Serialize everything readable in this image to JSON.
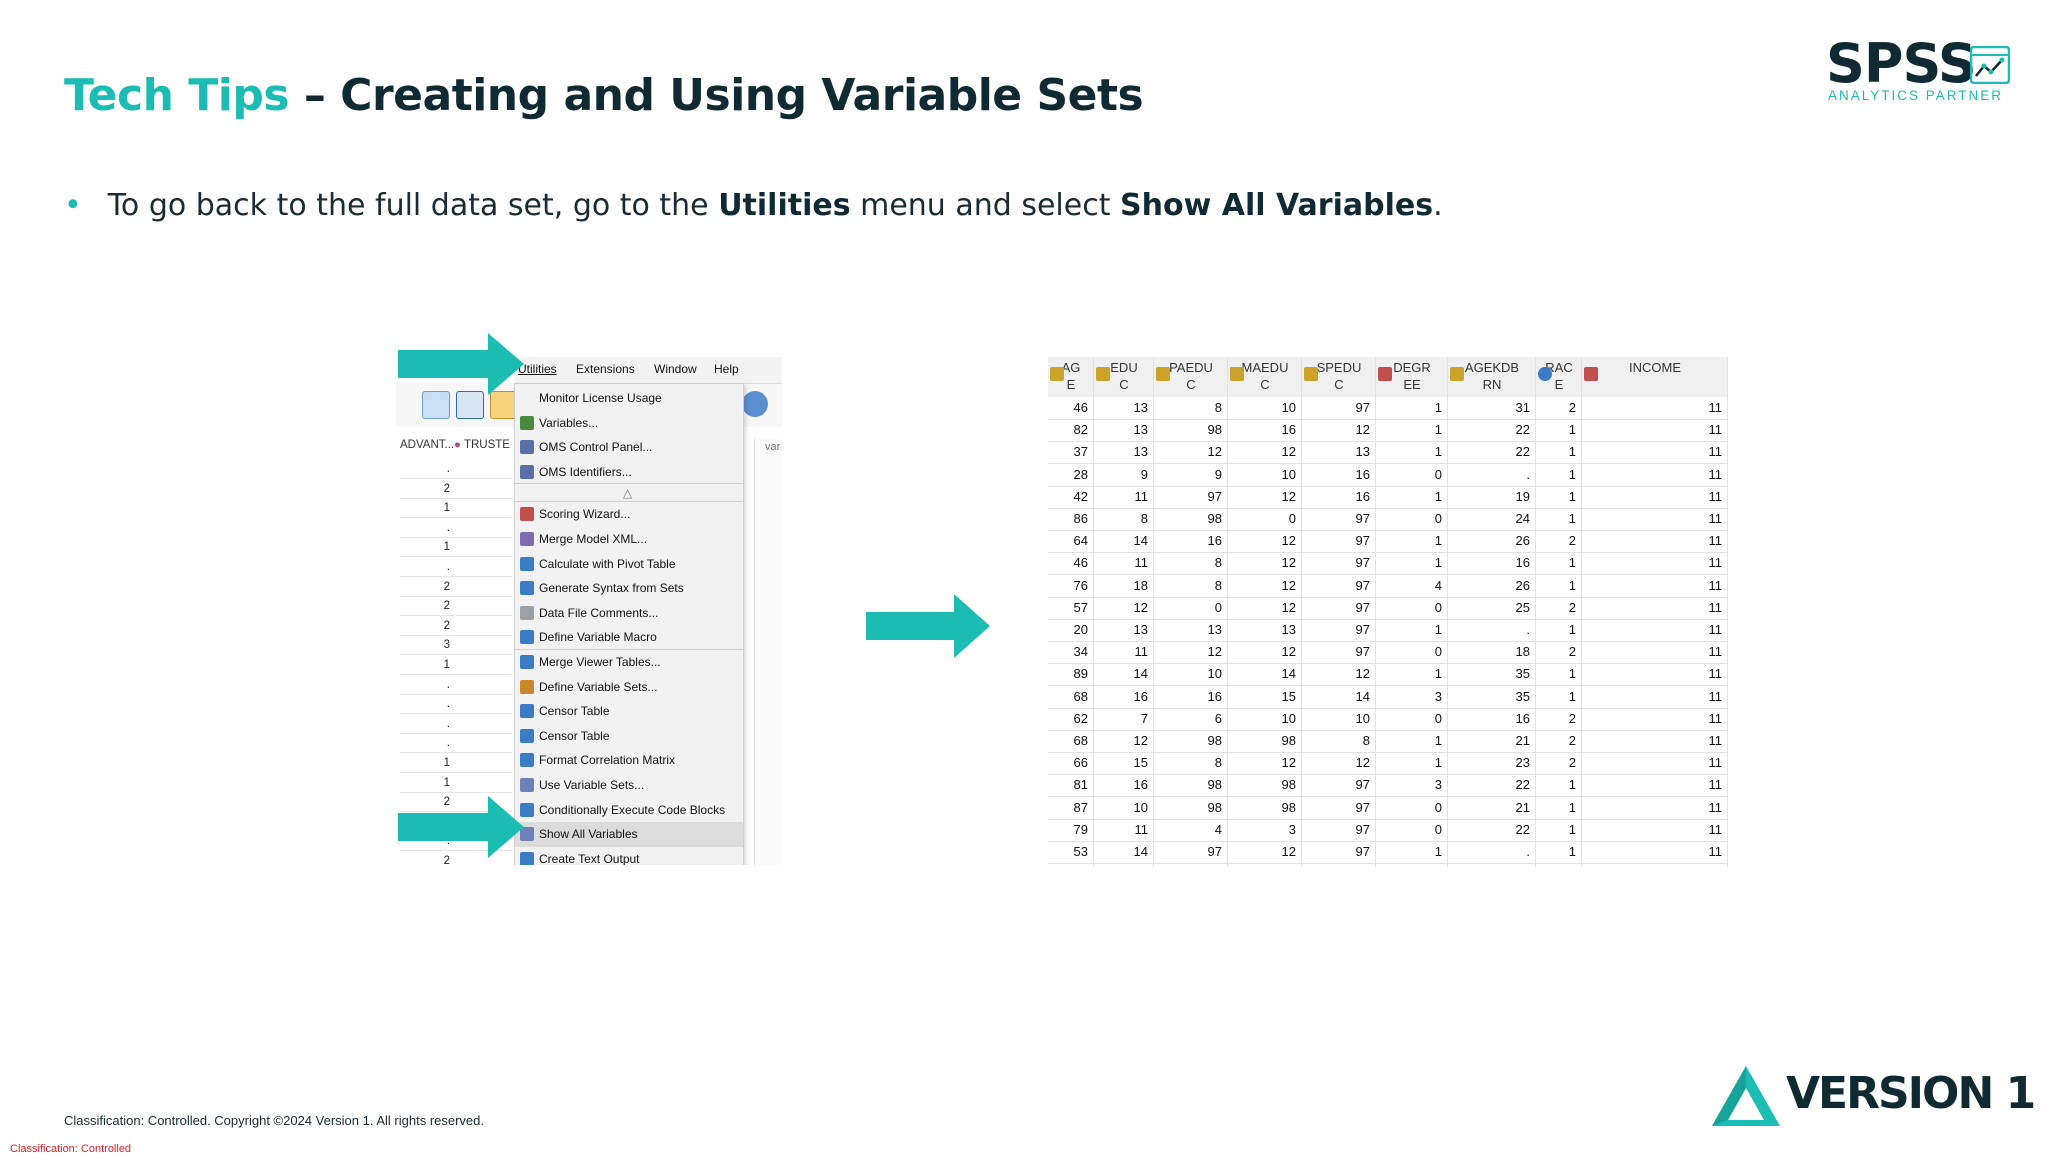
{
  "slide": {
    "title_accent": "Tech Tips",
    "title_rest": " – Creating and Using Variable Sets",
    "bullet_pre": "To go back to the full data set, go to the ",
    "bullet_b1": "Utilities",
    "bullet_mid": " menu and select ",
    "bullet_b2": "Show All Variables",
    "bullet_end": "."
  },
  "logo": {
    "word": "SPSS",
    "sub": "ANALYTICS PARTNER"
  },
  "menubar": [
    "Utilities",
    "Extensions",
    "Window",
    "Help"
  ],
  "left_grid": {
    "col1": "ADVANT...",
    "col2": "TRUSTE",
    "col3": "var",
    "values": [
      ".",
      "2",
      "1",
      ".",
      "1",
      ".",
      "2",
      "2",
      "2",
      "3",
      "1",
      ".",
      ".",
      ".",
      ".",
      "1",
      "1",
      "2",
      ".",
      ".",
      "2"
    ]
  },
  "utilities_menu": {
    "items": [
      {
        "label": "Monitor License Usage",
        "icon": "none"
      },
      {
        "label": "Variables...",
        "icon": "variables-icon"
      },
      {
        "label": "OMS Control Panel...",
        "icon": "oms-icon"
      },
      {
        "label": "OMS Identifiers...",
        "icon": "oms-icon"
      },
      {
        "label": "△",
        "icon": "none"
      },
      {
        "label": "Scoring Wizard...",
        "icon": "wizard-icon"
      },
      {
        "label": "Merge Model XML...",
        "icon": "xml-icon"
      },
      {
        "label": "Calculate with Pivot Table",
        "icon": "plus-icon"
      },
      {
        "label": "Generate Syntax from Sets",
        "icon": "plus-icon"
      },
      {
        "label": "Data File Comments...",
        "icon": "comments-icon"
      },
      {
        "label": "Define Variable Macro",
        "icon": "plus-icon"
      },
      {
        "label": "Merge Viewer Tables...",
        "icon": "plus-icon"
      },
      {
        "label": "Define Variable Sets...",
        "icon": "pencil-icon"
      },
      {
        "label": "Censor Table",
        "icon": "plus-icon"
      },
      {
        "label": "Censor Table",
        "icon": "plus-icon"
      },
      {
        "label": "Format Correlation Matrix",
        "icon": "plus-icon"
      },
      {
        "label": "Use Variable Sets...",
        "icon": "sets-icon"
      },
      {
        "label": "Conditionally Execute Code Blocks",
        "icon": "plus-icon"
      },
      {
        "label": "Show All Variables",
        "icon": "sets-icon"
      },
      {
        "label": "Create Text Output",
        "icon": "plus-icon"
      }
    ],
    "highlighted": "Show All Variables"
  },
  "data_table": {
    "columns": [
      {
        "name": "AG\nE",
        "l1": "AG",
        "l2": "E",
        "icon": "scale-icon"
      },
      {
        "name": "EDUC",
        "l1": "EDU",
        "l2": "C",
        "icon": "scale-icon"
      },
      {
        "name": "PAEDUC",
        "l1": "PAEDU",
        "l2": "C",
        "icon": "scale-icon"
      },
      {
        "name": "MAEDUC",
        "l1": "MAEDU",
        "l2": "C",
        "icon": "scale-icon"
      },
      {
        "name": "SPEDUC",
        "l1": "SPEDU",
        "l2": "C",
        "icon": "scale-icon"
      },
      {
        "name": "DEGREE",
        "l1": "DEGR",
        "l2": "EE",
        "icon": "ordinal-icon"
      },
      {
        "name": "AGEKDBRN",
        "l1": "AGEKDB",
        "l2": "RN",
        "icon": "scale-icon"
      },
      {
        "name": "RACE",
        "l1": "RAC",
        "l2": "E",
        "icon": "nominal-icon"
      },
      {
        "name": "INCOME",
        "l1": "INCOME",
        "l2": "",
        "icon": "ordinal-icon"
      }
    ],
    "rows": [
      [
        "46",
        "13",
        "8",
        "10",
        "97",
        "1",
        "31",
        "2",
        "11"
      ],
      [
        "82",
        "13",
        "98",
        "16",
        "12",
        "1",
        "22",
        "1",
        "11"
      ],
      [
        "37",
        "13",
        "12",
        "12",
        "13",
        "1",
        "22",
        "1",
        "11"
      ],
      [
        "28",
        "9",
        "9",
        "10",
        "16",
        "0",
        ".",
        "1",
        "11"
      ],
      [
        "42",
        "11",
        "97",
        "12",
        "16",
        "1",
        "19",
        "1",
        "11"
      ],
      [
        "86",
        "8",
        "98",
        "0",
        "97",
        "0",
        "24",
        "1",
        "11"
      ],
      [
        "64",
        "14",
        "16",
        "12",
        "97",
        "1",
        "26",
        "2",
        "11"
      ],
      [
        "46",
        "11",
        "8",
        "12",
        "97",
        "1",
        "16",
        "1",
        "11"
      ],
      [
        "76",
        "18",
        "8",
        "12",
        "97",
        "4",
        "26",
        "1",
        "11"
      ],
      [
        "57",
        "12",
        "0",
        "12",
        "97",
        "0",
        "25",
        "2",
        "11"
      ],
      [
        "20",
        "13",
        "13",
        "13",
        "97",
        "1",
        ".",
        "1",
        "11"
      ],
      [
        "34",
        "11",
        "12",
        "12",
        "97",
        "0",
        "18",
        "2",
        "11"
      ],
      [
        "89",
        "14",
        "10",
        "14",
        "12",
        "1",
        "35",
        "1",
        "11"
      ],
      [
        "68",
        "16",
        "16",
        "15",
        "14",
        "3",
        "35",
        "1",
        "11"
      ],
      [
        "62",
        "7",
        "6",
        "10",
        "10",
        "0",
        "16",
        "2",
        "11"
      ],
      [
        "68",
        "12",
        "98",
        "98",
        "8",
        "1",
        "21",
        "2",
        "11"
      ],
      [
        "66",
        "15",
        "8",
        "12",
        "12",
        "1",
        "23",
        "2",
        "11"
      ],
      [
        "81",
        "16",
        "98",
        "98",
        "97",
        "3",
        "22",
        "1",
        "11"
      ],
      [
        "87",
        "10",
        "98",
        "98",
        "97",
        "0",
        "21",
        "1",
        "11"
      ],
      [
        "79",
        "11",
        "4",
        "3",
        "97",
        "0",
        "22",
        "1",
        "11"
      ],
      [
        "53",
        "14",
        "97",
        "12",
        "97",
        "1",
        ".",
        "1",
        "11"
      ]
    ]
  },
  "footer": {
    "copyright": "Classification: Controlled. Copyright ©2024 Version 1. All rights reserved.",
    "classification": "Classification: Controlled",
    "brand": "VERSION 1"
  },
  "colors": {
    "accent": "#1bbdb3",
    "dark": "#0f2a33",
    "classification_red": "#e02020"
  }
}
